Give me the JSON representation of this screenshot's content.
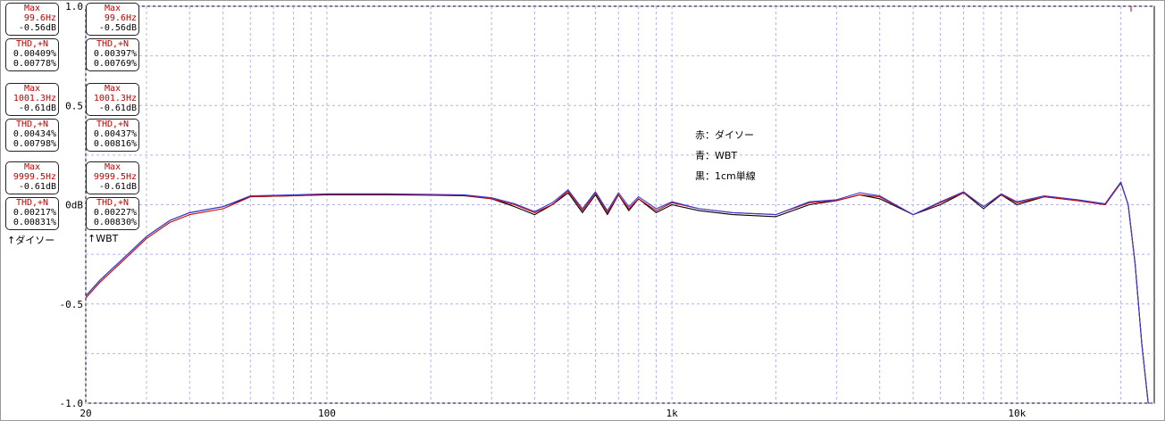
{
  "panels": [
    {
      "caption": "↑ダイソー",
      "boxes": [
        {
          "type": "max",
          "title": "Max",
          "freq": "99.6Hz",
          "level": "-0.56dB"
        },
        {
          "type": "thd",
          "title": "THD,+N",
          "v1": "0.00409%",
          "v2": "0.00778%"
        },
        {
          "type": "max",
          "title": "Max",
          "freq": "1001.3Hz",
          "level": "-0.61dB"
        },
        {
          "type": "thd",
          "title": "THD,+N",
          "v1": "0.00434%",
          "v2": "0.00798%"
        },
        {
          "type": "max",
          "title": "Max",
          "freq": "9999.5Hz",
          "level": "-0.61dB"
        },
        {
          "type": "thd",
          "title": "THD,+N",
          "v1": "0.00217%",
          "v2": "0.00831%"
        }
      ]
    },
    {
      "caption": "↑WBT",
      "boxes": [
        {
          "type": "max",
          "title": "Max",
          "freq": "99.6Hz",
          "level": "-0.56dB"
        },
        {
          "type": "thd",
          "title": "THD,+N",
          "v1": "0.00397%",
          "v2": "0.00769%"
        },
        {
          "type": "max",
          "title": "Max",
          "freq": "1001.3Hz",
          "level": "-0.61dB"
        },
        {
          "type": "thd",
          "title": "THD,+N",
          "v1": "0.00437%",
          "v2": "0.00816%"
        },
        {
          "type": "max",
          "title": "Max",
          "freq": "9999.5Hz",
          "level": "-0.61dB"
        },
        {
          "type": "thd",
          "title": "THD,+N",
          "v1": "0.00227%",
          "v2": "0.00830%"
        }
      ]
    }
  ],
  "notes": [
    "赤：ダイソー",
    "青：WBT",
    "黒：1cm単線"
  ],
  "colors": {
    "red": "#cc0000",
    "blue": "#3a3ad8",
    "black": "#000000",
    "grid": "#b4b4e6"
  },
  "chart_data": {
    "type": "line",
    "x_scale": "log",
    "xlim": [
      20,
      25000
    ],
    "ylim": [
      -1.0,
      1.0
    ],
    "x_ticks": [
      {
        "v": 20,
        "label": "20"
      },
      {
        "v": 100,
        "label": "100"
      },
      {
        "v": 1000,
        "label": "1k"
      },
      {
        "v": 10000,
        "label": "10k"
      }
    ],
    "y_ticks": [
      {
        "v": 1.0,
        "label": "1.0"
      },
      {
        "v": 0.5,
        "label": "0.5"
      },
      {
        "v": 0,
        "label": "0dB"
      },
      {
        "v": -0.5,
        "label": "-0.5"
      },
      {
        "v": -1.0,
        "label": "-1.0"
      }
    ],
    "grid": true,
    "series": [
      {
        "name": "黒：1cm単線",
        "color": "#000000",
        "x": [
          20,
          22,
          25,
          30,
          35,
          40,
          50,
          60,
          80,
          100,
          150,
          200,
          250,
          300,
          350,
          400,
          450,
          500,
          550,
          600,
          650,
          700,
          750,
          800,
          900,
          1000,
          1200,
          1500,
          2000,
          2500,
          3000,
          3500,
          4000,
          5000,
          6000,
          7000,
          8000,
          9000,
          10000,
          12000,
          15000,
          18000,
          20000,
          21000,
          22000,
          23000,
          24000,
          24500
        ],
        "y": [
          -0.46,
          -0.38,
          -0.29,
          -0.16,
          -0.08,
          -0.04,
          -0.01,
          0.04,
          0.045,
          0.05,
          0.05,
          0.048,
          0.045,
          0.03,
          -0.01,
          -0.05,
          0.0,
          0.06,
          -0.04,
          0.05,
          -0.05,
          0.05,
          -0.03,
          0.03,
          -0.04,
          0.0,
          -0.03,
          -0.05,
          -0.06,
          0.0,
          0.02,
          0.05,
          0.03,
          -0.05,
          0.0,
          0.06,
          -0.02,
          0.05,
          0.0,
          0.04,
          0.02,
          0.0,
          0.11,
          0.0,
          -0.3,
          -0.7,
          -1.0,
          -1.0
        ]
      },
      {
        "name": "赤：ダイソー",
        "color": "#cc0000",
        "x": [
          20,
          22,
          25,
          30,
          35,
          40,
          50,
          60,
          80,
          100,
          150,
          200,
          250,
          300,
          350,
          400,
          450,
          500,
          550,
          600,
          650,
          700,
          750,
          800,
          900,
          1000,
          1200,
          1500,
          2000,
          2500,
          3000,
          3500,
          4000,
          5000,
          6000,
          7000,
          8000,
          9000,
          10000,
          12000,
          15000,
          18000,
          20000,
          21000,
          22000,
          23000,
          24000,
          24500
        ],
        "y": [
          -0.47,
          -0.39,
          -0.3,
          -0.17,
          -0.09,
          -0.05,
          -0.02,
          0.04,
          0.045,
          0.052,
          0.052,
          0.05,
          0.047,
          0.03,
          0.0,
          -0.04,
          0.0,
          0.07,
          -0.03,
          0.06,
          -0.04,
          0.05,
          -0.02,
          0.03,
          -0.03,
          0.01,
          -0.02,
          -0.04,
          -0.05,
          0.01,
          0.02,
          0.05,
          0.04,
          -0.05,
          0.01,
          0.06,
          -0.01,
          0.05,
          0.01,
          0.04,
          0.02,
          0.0,
          0.11,
          0.0,
          -0.3,
          -0.7,
          -1.0,
          -1.0
        ]
      },
      {
        "name": "青：WBT",
        "color": "#3a3ad8",
        "x": [
          20,
          22,
          25,
          30,
          35,
          40,
          50,
          60,
          80,
          100,
          150,
          200,
          250,
          300,
          350,
          400,
          450,
          500,
          550,
          600,
          650,
          700,
          750,
          800,
          900,
          1000,
          1200,
          1500,
          2000,
          2500,
          3000,
          3500,
          4000,
          5000,
          6000,
          7000,
          8000,
          9000,
          10000,
          12000,
          15000,
          18000,
          20000,
          21000,
          22000,
          23000,
          24000,
          24500
        ],
        "y": [
          -0.46,
          -0.38,
          -0.29,
          -0.16,
          -0.08,
          -0.04,
          -0.01,
          0.045,
          0.05,
          0.055,
          0.055,
          0.052,
          0.05,
          0.035,
          0.005,
          -0.035,
          0.01,
          0.075,
          -0.02,
          0.065,
          -0.03,
          0.06,
          -0.01,
          0.04,
          -0.02,
          0.015,
          -0.02,
          -0.04,
          -0.05,
          0.015,
          0.025,
          0.06,
          0.045,
          -0.05,
          0.015,
          0.065,
          -0.01,
          0.055,
          0.015,
          0.045,
          0.025,
          0.005,
          0.115,
          0.0,
          -0.3,
          -0.7,
          -1.0,
          -1.0
        ]
      }
    ]
  }
}
